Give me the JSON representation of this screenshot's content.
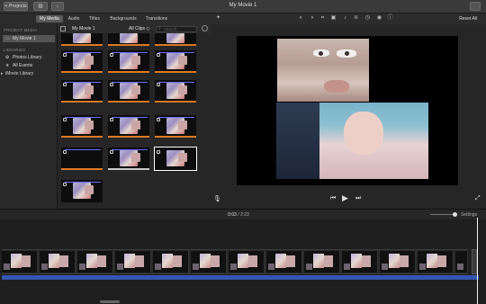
{
  "window": {
    "title": "My Movie 1"
  },
  "toolbar": {
    "projects_label": "< Projects"
  },
  "tabs": [
    {
      "label": "My Media",
      "active": true
    },
    {
      "label": "Audio",
      "active": false
    },
    {
      "label": "Titles",
      "active": false
    },
    {
      "label": "Backgrounds",
      "active": false
    },
    {
      "label": "Transitions",
      "active": false
    }
  ],
  "viewer_toolbar": {
    "reset_label": "Reset All"
  },
  "sidebar": {
    "project_header": "PROJECT MEDIA",
    "project_item": "My Movie 1",
    "libraries_header": "LIBRARIES",
    "items": [
      "Photos Library",
      "All Events",
      "iMovie Library"
    ]
  },
  "browser": {
    "title": "My Movie 1",
    "filter": "All Clips ◇",
    "search_placeholder": "Search"
  },
  "timeline": {
    "current_time": "0:03",
    "separator": " / ",
    "total_time": "2:23",
    "settings_label": "Settings"
  },
  "colors": {
    "accent": "#d97a26",
    "audio_track": "#3456b0",
    "selection": "#ffffff"
  }
}
